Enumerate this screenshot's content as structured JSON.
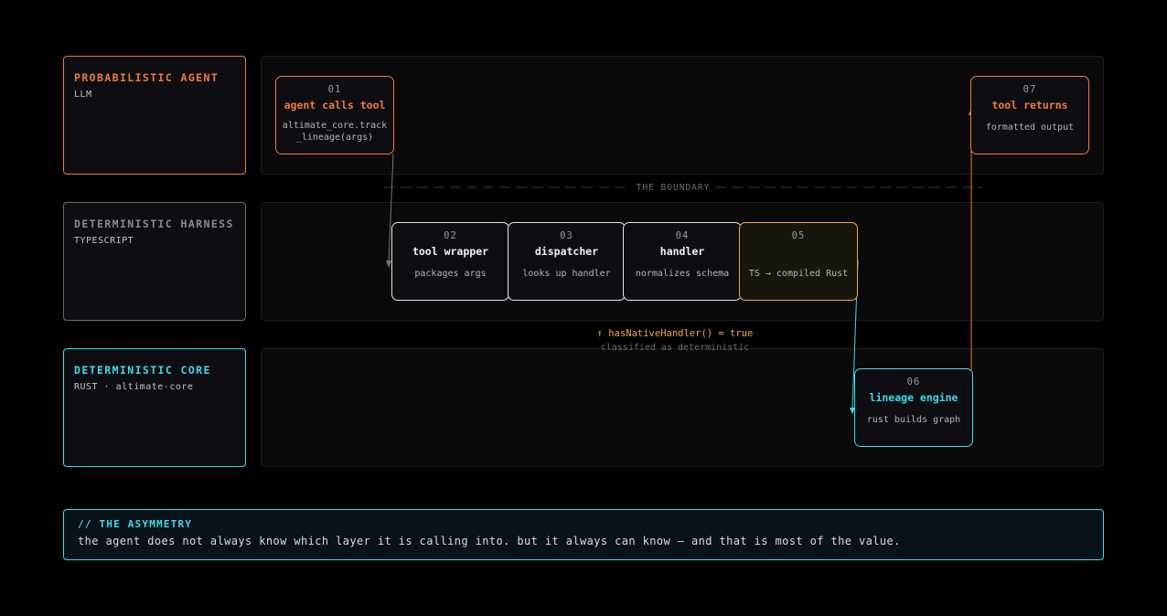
{
  "colors": {
    "agent": "#f07a3c",
    "harness": "#8a8a8a",
    "core": "#3ddcec",
    "native": "#f0a840",
    "white": "#e6e6e6"
  },
  "lanes": [
    {
      "title": "PROBABILISTIC AGENT",
      "subtitle": "LLM"
    },
    {
      "title": "DETERMINISTIC HARNESS",
      "subtitle": "TYPESCRIPT"
    },
    {
      "title": "DETERMINISTIC CORE",
      "subtitle": "RUST · altimate-core"
    }
  ],
  "boundary": {
    "label": "THE BOUNDARY"
  },
  "steps": [
    {
      "num": "01",
      "title": "agent calls tool",
      "desc": "altimate_core.track\n_lineage(args)"
    },
    {
      "num": "02",
      "title": "tool wrapper",
      "desc": "packages args"
    },
    {
      "num": "03",
      "title": "dispatcher",
      "desc": "looks up handler"
    },
    {
      "num": "04",
      "title": "handler",
      "desc": "normalizes schema"
    },
    {
      "num": "05",
      "title": "",
      "desc": "TS → compiled Rust"
    },
    {
      "num": "06",
      "title": "lineage engine",
      "desc": "rust builds graph"
    },
    {
      "num": "07",
      "title": "tool returns",
      "desc": "formatted output"
    }
  ],
  "native_note": {
    "line1": "↑ hasNativeHandler() = true",
    "line2": "classified as deterministic"
  },
  "asymmetry": {
    "title": "// THE ASYMMETRY",
    "body": "the agent does not always know which layer it is calling into. but it always can know — and that is most of the value."
  }
}
